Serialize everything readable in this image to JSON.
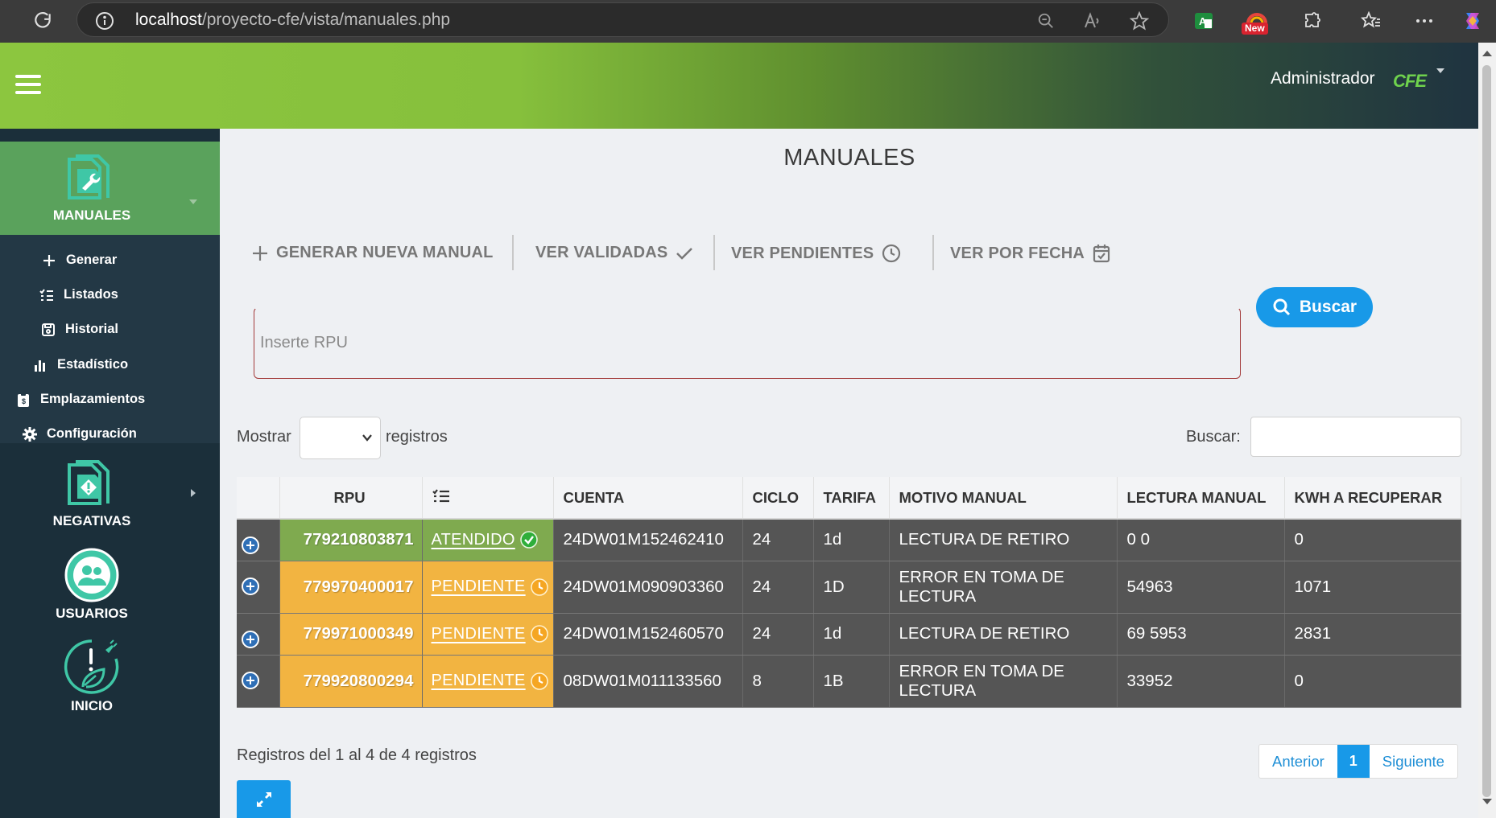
{
  "browser": {
    "url_host": "localhost",
    "url_path": "/proyecto-cfe/vista/manuales.php",
    "new_badge": "New"
  },
  "header": {
    "user_label": "Administrador",
    "logo_text": "CFE"
  },
  "sidebar": {
    "manuales_label": "MANUALES",
    "submenu": [
      {
        "label": "Generar",
        "icon": "plus-icon"
      },
      {
        "label": "Listados",
        "icon": "list-icon"
      },
      {
        "label": "Historial",
        "icon": "save-icon"
      },
      {
        "label": "Estadístico",
        "icon": "bar-chart-icon"
      },
      {
        "label": "Emplazamientos",
        "icon": "clipboard-icon"
      },
      {
        "label": "Configuración",
        "icon": "gear-icon"
      }
    ],
    "negativas_label": "NEGATIVAS",
    "usuarios_label": "USUARIOS",
    "inicio_label": "INICIO"
  },
  "main": {
    "title": "MANUALES",
    "actions": {
      "generar": "GENERAR NUEVA MANUAL",
      "validadas": "VER VALIDADAS",
      "pendientes": "VER PENDIENTES",
      "fecha": "VER POR FECHA"
    },
    "search": {
      "placeholder": "Inserte RPU",
      "button": "Buscar"
    },
    "length": {
      "prefix": "Mostrar",
      "suffix": "registros"
    },
    "filter_label": "Buscar:",
    "table": {
      "headers": [
        "RPU",
        "",
        "CUENTA",
        "CICLO",
        "TARIFA",
        "MOTIVO MANUAL",
        "LECTURA MANUAL",
        "KWH A RECUPERAR"
      ],
      "rows": [
        {
          "rpu": "779210803871",
          "status": "ATENDIDO",
          "cuenta": "24DW01M152462410",
          "ciclo": "24",
          "tarifa": "1d",
          "motivo": "LECTURA DE RETIRO",
          "lectura": "0 0",
          "kwh": "0"
        },
        {
          "rpu": "779970400017",
          "status": "PENDIENTE",
          "cuenta": "24DW01M090903360",
          "ciclo": "24",
          "tarifa": "1D",
          "motivo": "ERROR EN TOMA DE LECTURA",
          "lectura": "54963",
          "kwh": "1071"
        },
        {
          "rpu": "779971000349",
          "status": "PENDIENTE",
          "cuenta": "24DW01M152460570",
          "ciclo": "24",
          "tarifa": "1d",
          "motivo": "LECTURA DE RETIRO",
          "lectura": "69 5953",
          "kwh": "2831"
        },
        {
          "rpu": "779920800294",
          "status": "PENDIENTE",
          "cuenta": "08DW01M011133560",
          "ciclo": "8",
          "tarifa": "1B",
          "motivo": "ERROR EN TOMA DE LECTURA",
          "lectura": "33952",
          "kwh": "0"
        }
      ]
    },
    "info": "Registros del 1 al 4 de 4 registros",
    "pagination": {
      "prev": "Anterior",
      "current": "1",
      "next": "Siguiente"
    }
  },
  "colors": {
    "atendido": "#7faa4f",
    "pendiente": "#f2b441",
    "accent": "#1899e8"
  }
}
